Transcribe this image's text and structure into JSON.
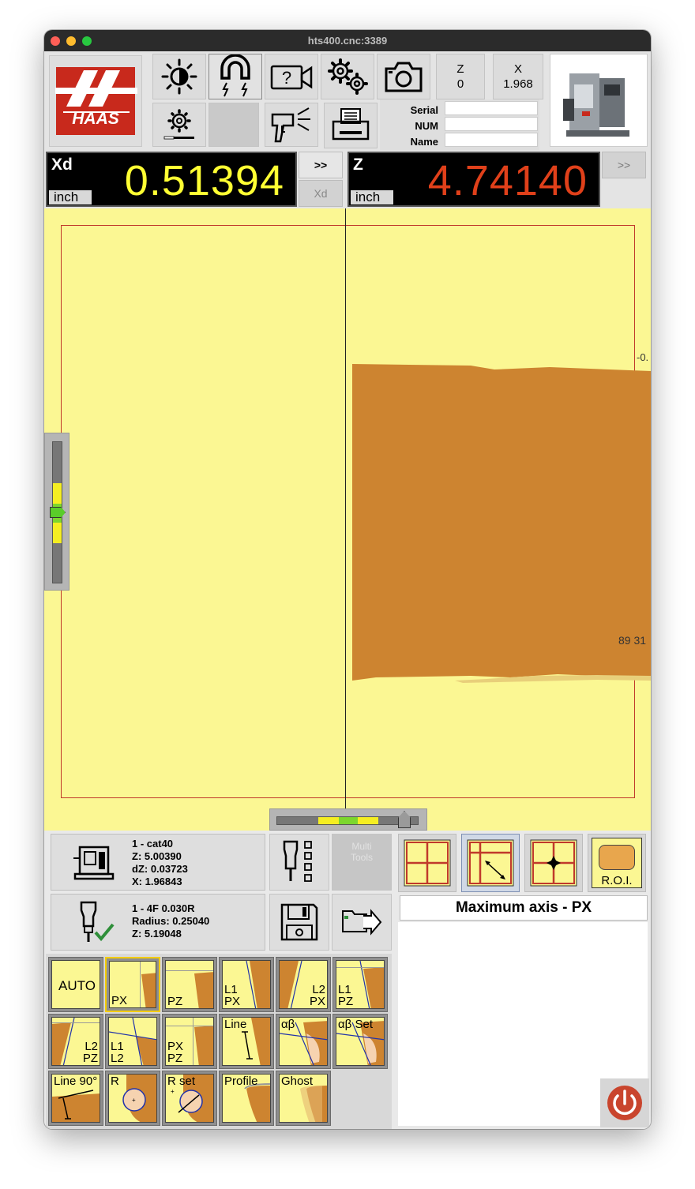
{
  "window": {
    "title": "hts400.cnc:3389"
  },
  "info": {
    "z_label": "Z",
    "z_value": "0",
    "x_label": "X",
    "x_value": "1.968",
    "serial_label": "Serial",
    "num_label": "NUM",
    "name_label": "Name",
    "serial_value": "",
    "num_value": "",
    "name_value": ""
  },
  "dro_x": {
    "label": "Xd",
    "value": "0.51394",
    "unit": "inch",
    "color": "#ffff33"
  },
  "dro_z": {
    "label": "Z",
    "value": "4.74140",
    "unit": "inch",
    "color": "#e0401a"
  },
  "dro_buttons": {
    "x_expand": ">>",
    "x_mode": "Xd",
    "z_expand": ">>"
  },
  "view": {
    "background": "#fbf793",
    "part_color": "#cd8430",
    "roi_color": "#c0392b",
    "label_right_top": "-0.",
    "label_right_mid": "89 31",
    "focus_level": 0.5,
    "light_level": 0.9
  },
  "machine": {
    "line1": "1 - cat40",
    "line2": "Z: 5.00390",
    "line3": "dZ: 0.03723",
    "line4": "X: 1.96843"
  },
  "tool": {
    "line1": "1 - 4F 0.030R",
    "line2": "Radius: 0.25040",
    "line3": "Z: 5.19048"
  },
  "multi_tools": {
    "label": "Multi Tools"
  },
  "mode": {
    "label": "Maximum axis - PX"
  },
  "roi": {
    "label": "R.O.I."
  },
  "measure": {
    "auto": "AUTO",
    "px": "PX",
    "pz": "PZ",
    "l1px_a": "L1",
    "l1px_b": "PX",
    "l2px_a": "L2",
    "l2px_b": "PX",
    "l1pz_a": "L1",
    "l1pz_b": "PZ",
    "l2pz_a": "L2",
    "l2pz_b": "PZ",
    "l1l2_a": "L1",
    "l1l2_b": "L2",
    "pxpz_a": "PX",
    "pxpz_b": "PZ",
    "line": "Line",
    "ab": "αβ",
    "abset": "αβ Set",
    "line90": "Line 90°",
    "r": "R",
    "rset": "R set",
    "profile": "Profile",
    "ghost": "Ghost"
  }
}
